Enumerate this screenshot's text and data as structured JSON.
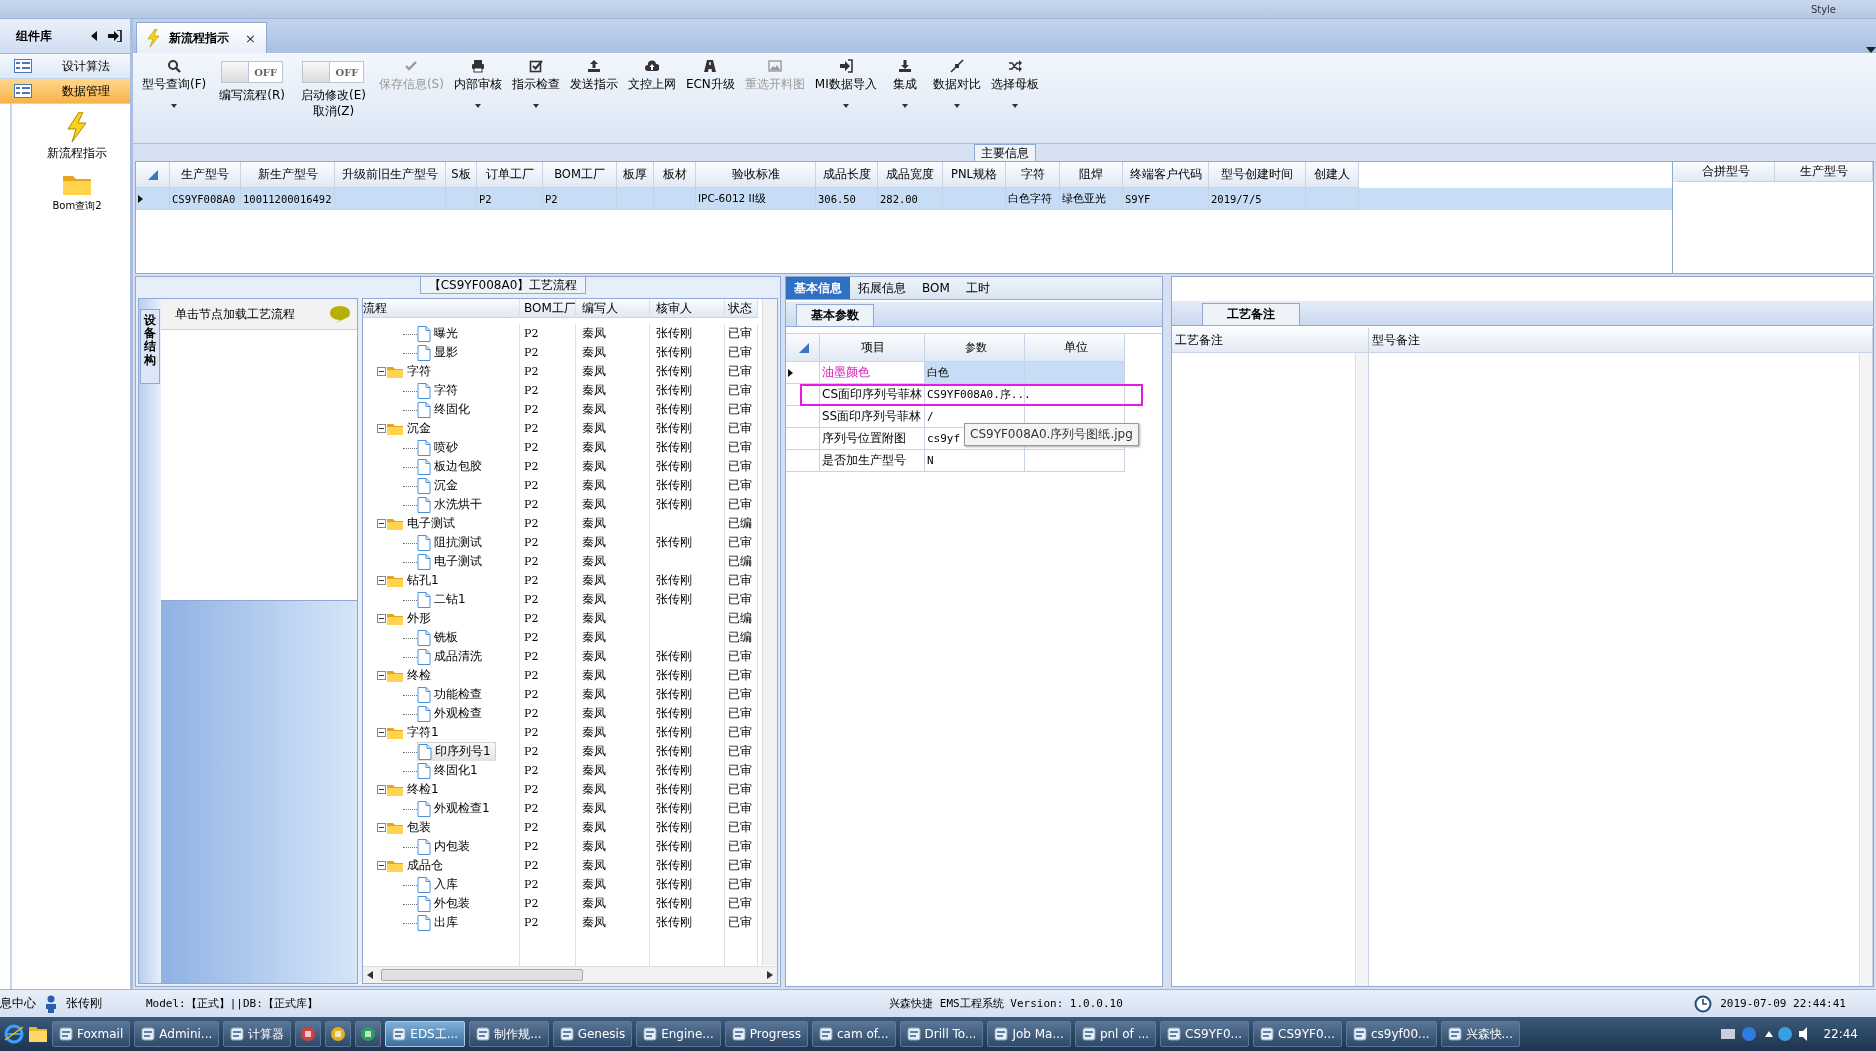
{
  "menu_bar": {
    "style_label": "Style"
  },
  "sidebar": {
    "title": "组件库",
    "items": [
      {
        "label": "设计算法",
        "selected": false
      },
      {
        "label": "数据管理",
        "selected": true
      }
    ],
    "tools": [
      {
        "label": "新流程指示",
        "kind": "bolt"
      },
      {
        "label": "Bom查询2",
        "kind": "folder"
      }
    ]
  },
  "document_tab": {
    "title": "新流程指示",
    "close": "×"
  },
  "toolbar": [
    {
      "kind": "button",
      "lines": [
        "型号查询(F)"
      ],
      "dropdown": true,
      "disabled": false
    },
    {
      "kind": "toggle",
      "on": false,
      "state_text": "OFF",
      "lines": [
        "编写流程(R)"
      ]
    },
    {
      "kind": "toggle",
      "on": false,
      "state_text": "OFF",
      "lines": [
        "启动修改(E)",
        "取消(Z)"
      ]
    },
    {
      "kind": "button",
      "lines": [
        "保存信息(S)"
      ],
      "dropdown": false,
      "disabled": true
    },
    {
      "kind": "button",
      "lines": [
        "内部审核"
      ],
      "dropdown": true,
      "disabled": false
    },
    {
      "kind": "button",
      "lines": [
        "指示检查"
      ],
      "dropdown": true,
      "disabled": false
    },
    {
      "kind": "button",
      "lines": [
        "发送指示"
      ],
      "dropdown": false,
      "disabled": false
    },
    {
      "kind": "button",
      "lines": [
        "文控上网"
      ],
      "dropdown": false,
      "disabled": false
    },
    {
      "kind": "button",
      "lines": [
        "ECN升级"
      ],
      "dropdown": false,
      "disabled": false
    },
    {
      "kind": "button",
      "lines": [
        "重选开料图"
      ],
      "dropdown": false,
      "disabled": true
    },
    {
      "kind": "button",
      "lines": [
        "MI数据导入"
      ],
      "dropdown": true,
      "disabled": false
    },
    {
      "kind": "button",
      "lines": [
        "集成"
      ],
      "dropdown": true,
      "disabled": false
    },
    {
      "kind": "button",
      "lines": [
        "数据对比"
      ],
      "dropdown": true,
      "disabled": false
    },
    {
      "kind": "button",
      "lines": [
        "选择母板"
      ],
      "dropdown": true,
      "disabled": false
    }
  ],
  "main_info": {
    "title": "主要信息",
    "columns": [
      "生产型号",
      "新生产型号",
      "升级前旧生产型号",
      "S板",
      "订单工厂",
      "BOM工厂",
      "板厚",
      "板材",
      "验收标准",
      "成品长度",
      "成品宽度",
      "PNL规格",
      "字符",
      "阻焊",
      "终端客户代码",
      "型号创建时间",
      "创建人"
    ],
    "rows": [
      {
        "selected": true,
        "cells": [
          "CS9YF008A0",
          "10011200016492",
          null,
          null,
          "P2",
          "P2",
          null,
          null,
          "IPC-6012 II级",
          "306.50",
          "282.00",
          null,
          "白色字符",
          "绿色亚光",
          "S9YF",
          "2019/7/5",
          null
        ]
      }
    ],
    "side_columns": [
      "合拼型号",
      "生产型号"
    ]
  },
  "equipment_panel": {
    "tab": "设备结构",
    "hint": "单击节点加载工艺流程"
  },
  "process_tree": {
    "title": "【CS9YF008A0】工艺流程",
    "columns": [
      "流程",
      "BOM工厂",
      "编写人",
      "核审人",
      "状态"
    ],
    "nodes": [
      {
        "children": [
          {
            "name": "曝光",
            "bom": "P2",
            "writer": "秦凤",
            "reviewer": "张传刚",
            "status": "已审",
            "selected": false
          },
          {
            "name": "显影",
            "bom": "P2",
            "writer": "秦凤",
            "reviewer": "张传刚",
            "status": "已审",
            "selected": false
          }
        ]
      },
      {
        "name": "字符",
        "bom": "P2",
        "writer": "秦凤",
        "reviewer": "张传刚",
        "status": "已审",
        "selected": false,
        "children": [
          {
            "name": "字符",
            "bom": "P2",
            "writer": "秦凤",
            "reviewer": "张传刚",
            "status": "已审",
            "selected": false
          },
          {
            "name": "终固化",
            "bom": "P2",
            "writer": "秦凤",
            "reviewer": "张传刚",
            "status": "已审",
            "selected": false
          }
        ]
      },
      {
        "name": "沉金",
        "bom": "P2",
        "writer": "秦凤",
        "reviewer": "张传刚",
        "status": "已审",
        "selected": false,
        "children": [
          {
            "name": "喷砂",
            "bom": "P2",
            "writer": "秦凤",
            "reviewer": "张传刚",
            "status": "已审",
            "selected": false
          },
          {
            "name": "板边包胶",
            "bom": "P2",
            "writer": "秦凤",
            "reviewer": "张传刚",
            "status": "已审",
            "selected": false
          },
          {
            "name": "沉金",
            "bom": "P2",
            "writer": "秦凤",
            "reviewer": "张传刚",
            "status": "已审",
            "selected": false
          },
          {
            "name": "水洗烘干",
            "bom": "P2",
            "writer": "秦凤",
            "reviewer": "张传刚",
            "status": "已审",
            "selected": false
          }
        ]
      },
      {
        "name": "电子测试",
        "bom": "P2",
        "writer": "秦凤",
        "status": "已编",
        "selected": false,
        "children": [
          {
            "name": "阻抗测试",
            "bom": "P2",
            "writer": "秦凤",
            "reviewer": "张传刚",
            "status": "已审",
            "selected": false
          },
          {
            "name": "电子测试",
            "bom": "P2",
            "writer": "秦凤",
            "status": "已编",
            "selected": false
          }
        ]
      },
      {
        "name": "钻孔1",
        "bom": "P2",
        "writer": "秦凤",
        "reviewer": "张传刚",
        "status": "已审",
        "selected": false,
        "children": [
          {
            "name": "二钻1",
            "bom": "P2",
            "writer": "秦凤",
            "reviewer": "张传刚",
            "status": "已审",
            "selected": false
          }
        ]
      },
      {
        "name": "外形",
        "bom": "P2",
        "writer": "秦凤",
        "status": "已编",
        "selected": false,
        "children": [
          {
            "name": "铣板",
            "bom": "P2",
            "writer": "秦凤",
            "status": "已编",
            "selected": false
          },
          {
            "name": "成品清洗",
            "bom": "P2",
            "writer": "秦凤",
            "reviewer": "张传刚",
            "status": "已审",
            "selected": false
          }
        ]
      },
      {
        "name": "终检",
        "bom": "P2",
        "writer": "秦凤",
        "reviewer": "张传刚",
        "status": "已审",
        "selected": false,
        "children": [
          {
            "name": "功能检查",
            "bom": "P2",
            "writer": "秦凤",
            "reviewer": "张传刚",
            "status": "已审",
            "selected": false
          },
          {
            "name": "外观检查",
            "bom": "P2",
            "writer": "秦凤",
            "reviewer": "张传刚",
            "status": "已审",
            "selected": false
          }
        ]
      },
      {
        "name": "字符1",
        "bom": "P2",
        "writer": "秦凤",
        "reviewer": "张传刚",
        "status": "已审",
        "selected": false,
        "children": [
          {
            "name": "印序列号1",
            "bom": "P2",
            "writer": "秦凤",
            "reviewer": "张传刚",
            "status": "已审",
            "selected": true
          },
          {
            "name": "终固化1",
            "bom": "P2",
            "writer": "秦凤",
            "reviewer": "张传刚",
            "status": "已审",
            "selected": false
          }
        ]
      },
      {
        "name": "终检1",
        "bom": "P2",
        "writer": "秦凤",
        "reviewer": "张传刚",
        "status": "已审",
        "selected": false,
        "children": [
          {
            "name": "外观检查1",
            "bom": "P2",
            "writer": "秦凤",
            "reviewer": "张传刚",
            "status": "已审",
            "selected": false
          }
        ]
      },
      {
        "name": "包装",
        "bom": "P2",
        "writer": "秦凤",
        "reviewer": "张传刚",
        "status": "已审",
        "selected": false,
        "children": [
          {
            "name": "内包装",
            "bom": "P2",
            "writer": "秦凤",
            "reviewer": "张传刚",
            "status": "已审",
            "selected": false
          }
        ]
      },
      {
        "name": "成品仓",
        "bom": "P2",
        "writer": "秦凤",
        "reviewer": "张传刚",
        "status": "已审",
        "selected": false,
        "children": [
          {
            "name": "入库",
            "bom": "P2",
            "writer": "秦凤",
            "reviewer": "张传刚",
            "status": "已审",
            "selected": false
          },
          {
            "name": "外包装",
            "bom": "P2",
            "writer": "秦凤",
            "reviewer": "张传刚",
            "status": "已审",
            "selected": false
          },
          {
            "name": "出库",
            "bom": "P2",
            "writer": "秦凤",
            "reviewer": "张传刚",
            "status": "已审",
            "selected": false
          }
        ]
      }
    ]
  },
  "detail_tabs": [
    {
      "label": "基本信息",
      "selected": true
    },
    {
      "label": "拓展信息",
      "selected": false
    },
    {
      "label": "BOM",
      "selected": false
    },
    {
      "label": "工时",
      "selected": false
    }
  ],
  "params": {
    "tab": "基本参数",
    "columns": [
      "项目",
      "参数",
      "单位"
    ],
    "rows": [
      {
        "item": "油墨颜色",
        "value": "白色",
        "selected": true,
        "marked": false
      },
      {
        "item": "CS面印序列号菲林",
        "value": "CS9YF008A0.序...",
        "selected": false,
        "marked": true
      },
      {
        "item": "SS面印序列号菲林",
        "value": "/",
        "selected": false,
        "marked": false
      },
      {
        "item": "序列号位置附图",
        "value": "cs9yf",
        "selected": false,
        "marked": false
      },
      {
        "item": "是否加生产型号",
        "value": "N",
        "selected": false,
        "marked": false
      }
    ],
    "tooltip": "CS9YF008A0.序列号图纸.jpg"
  },
  "notes": {
    "tab": "工艺备注",
    "columns": [
      "工艺备注",
      "型号备注"
    ]
  },
  "status_bar": {
    "message_center": "息中心",
    "user": "张传刚",
    "model": "Model:【正式】||DB:【正式库】",
    "system": "兴森快捷 EMS工程系统 Version: 1.0.0.10",
    "datetime": "2019-07-09 22:44:41"
  },
  "taskbar": {
    "items": [
      {
        "kind": "task",
        "label": "Foxmail",
        "selected": false
      },
      {
        "kind": "task",
        "label": "Admini...",
        "selected": false
      },
      {
        "kind": "task",
        "label": "计算器",
        "selected": false
      },
      {
        "kind": "icon",
        "selected": false
      },
      {
        "kind": "icon",
        "selected": false
      },
      {
        "kind": "icon",
        "selected": false
      },
      {
        "kind": "task",
        "label": "EDS工...",
        "selected": true
      },
      {
        "kind": "task",
        "label": "制作规...",
        "selected": false
      },
      {
        "kind": "task",
        "label": "Genesis",
        "selected": false
      },
      {
        "kind": "task",
        "label": "Engine...",
        "selected": false
      },
      {
        "kind": "task",
        "label": "Progress",
        "selected": false
      },
      {
        "kind": "task",
        "label": "cam of...",
        "selected": false
      },
      {
        "kind": "task",
        "label": "Drill To...",
        "selected": false
      },
      {
        "kind": "task",
        "label": "Job Ma...",
        "selected": false
      },
      {
        "kind": "task",
        "label": "pnl of ...",
        "selected": false
      },
      {
        "kind": "task",
        "label": "CS9YF0...",
        "selected": false
      },
      {
        "kind": "task",
        "label": "CS9YF0...",
        "selected": false
      },
      {
        "kind": "task",
        "label": "cs9yf00...",
        "selected": false
      },
      {
        "kind": "task",
        "label": "兴森快...",
        "selected": false
      }
    ],
    "time": "22:44"
  }
}
